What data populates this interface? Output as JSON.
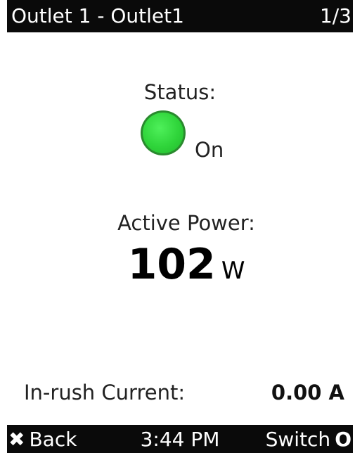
{
  "header": {
    "title": "Outlet 1 - Outlet1",
    "page_indicator": "1/3"
  },
  "status": {
    "label": "Status:",
    "value": "On",
    "indicator_color": "#2fd43a"
  },
  "power": {
    "label": "Active Power:",
    "value": "102",
    "unit": "W"
  },
  "inrush": {
    "label": "In-rush Current:",
    "value": "0.00 A"
  },
  "footer": {
    "back_icon": "✖",
    "back_label": "Back",
    "time": "3:44 PM",
    "switch_label": "Switch",
    "switch_icon": "O"
  }
}
